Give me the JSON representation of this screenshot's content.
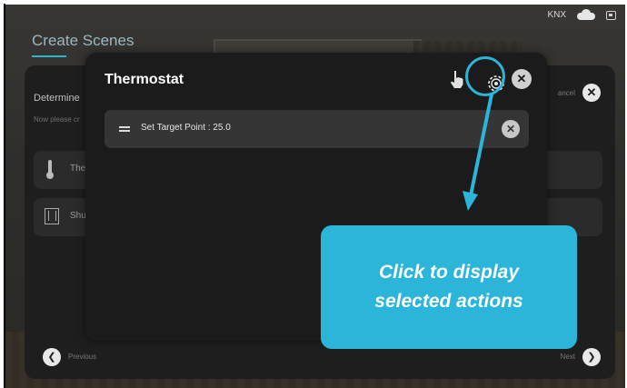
{
  "status": {
    "protocol": "KNX",
    "cloud_icon": "cloud-icon",
    "window_icon": "window-icon"
  },
  "page": {
    "title": "Create Scenes"
  },
  "base_panel": {
    "heading": "Determine",
    "subheading": "Now please cr",
    "cancel": "ancel",
    "rows": [
      {
        "label": "The",
        "icon": "thermometer-icon"
      },
      {
        "label": "Shu",
        "icon": "shutter-icon"
      }
    ],
    "previous": "Previous",
    "next": "Next"
  },
  "modal": {
    "title": "Thermostat",
    "actions": [
      {
        "label": "Set Target Point : 25.0"
      }
    ]
  },
  "callout": {
    "text": "Click to display selected actions"
  },
  "colors": {
    "accent": "#2ab5d9",
    "modal_bg": "#1b1b1b",
    "row_bg": "#353535"
  }
}
